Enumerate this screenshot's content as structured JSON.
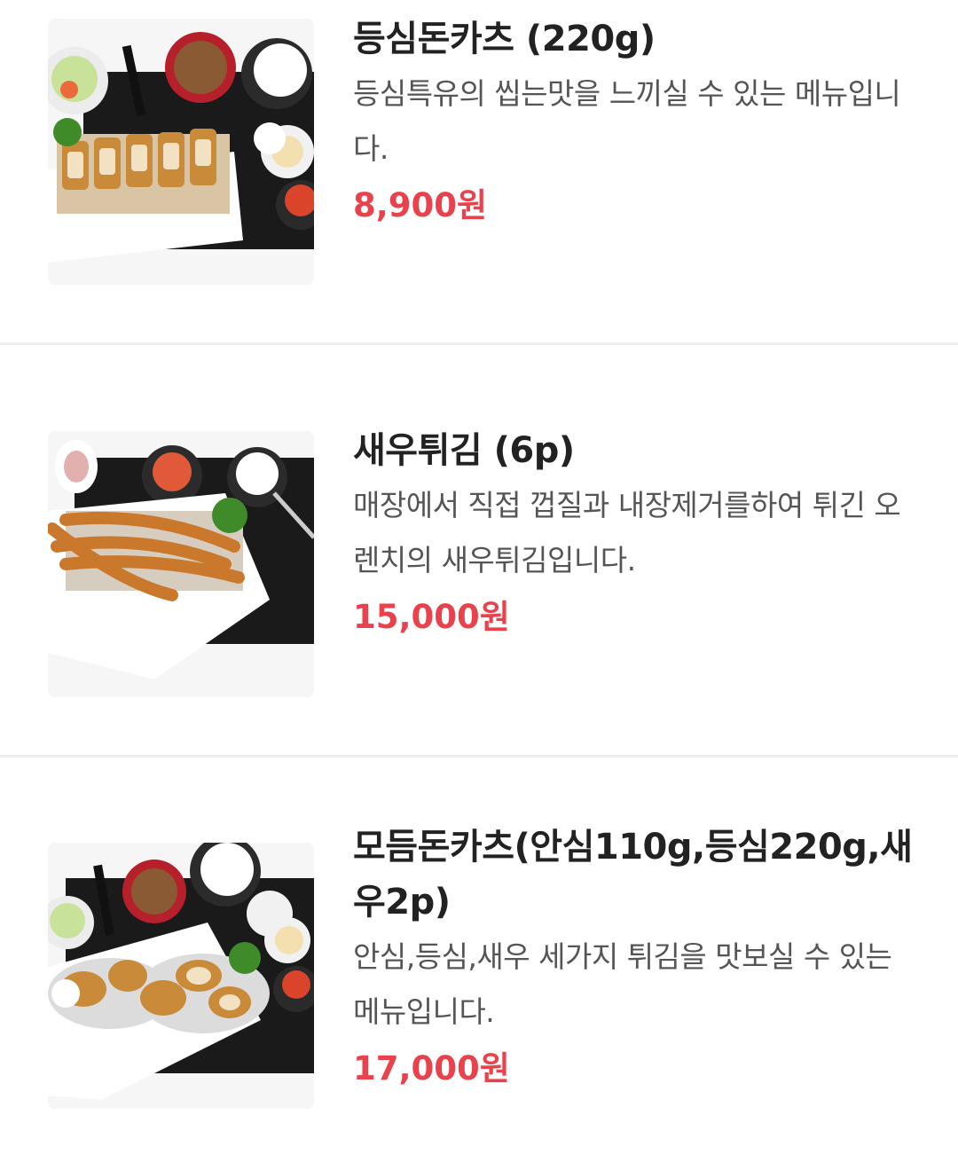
{
  "menu": {
    "items": [
      {
        "name": "등심돈카츠 (220g)",
        "description": "등심특유의 씹는맛을 느끼실 수 있는 메뉴입니다.",
        "price": "8,900원",
        "image_icon": "pork-cutlet-set-image"
      },
      {
        "name": "새우튀김 (6p)",
        "description": "매장에서 직접 껍질과 내장제거를하여 튀긴 오렌치의 새우튀김입니다.",
        "price": "15,000원",
        "image_icon": "fried-shrimp-image"
      },
      {
        "name": "모듬돈카츠(안심110g,등심220g,새우2p)",
        "description": "안심,등심,새우 세가지 튀김을 맛보실 수 있는 메뉴입니다.",
        "price": "17,000원",
        "image_icon": "assorted-cutlet-set-image"
      }
    ]
  },
  "colors": {
    "price": "#e8434c",
    "title": "#222222",
    "description": "#555555",
    "divider": "#eeeeee"
  }
}
